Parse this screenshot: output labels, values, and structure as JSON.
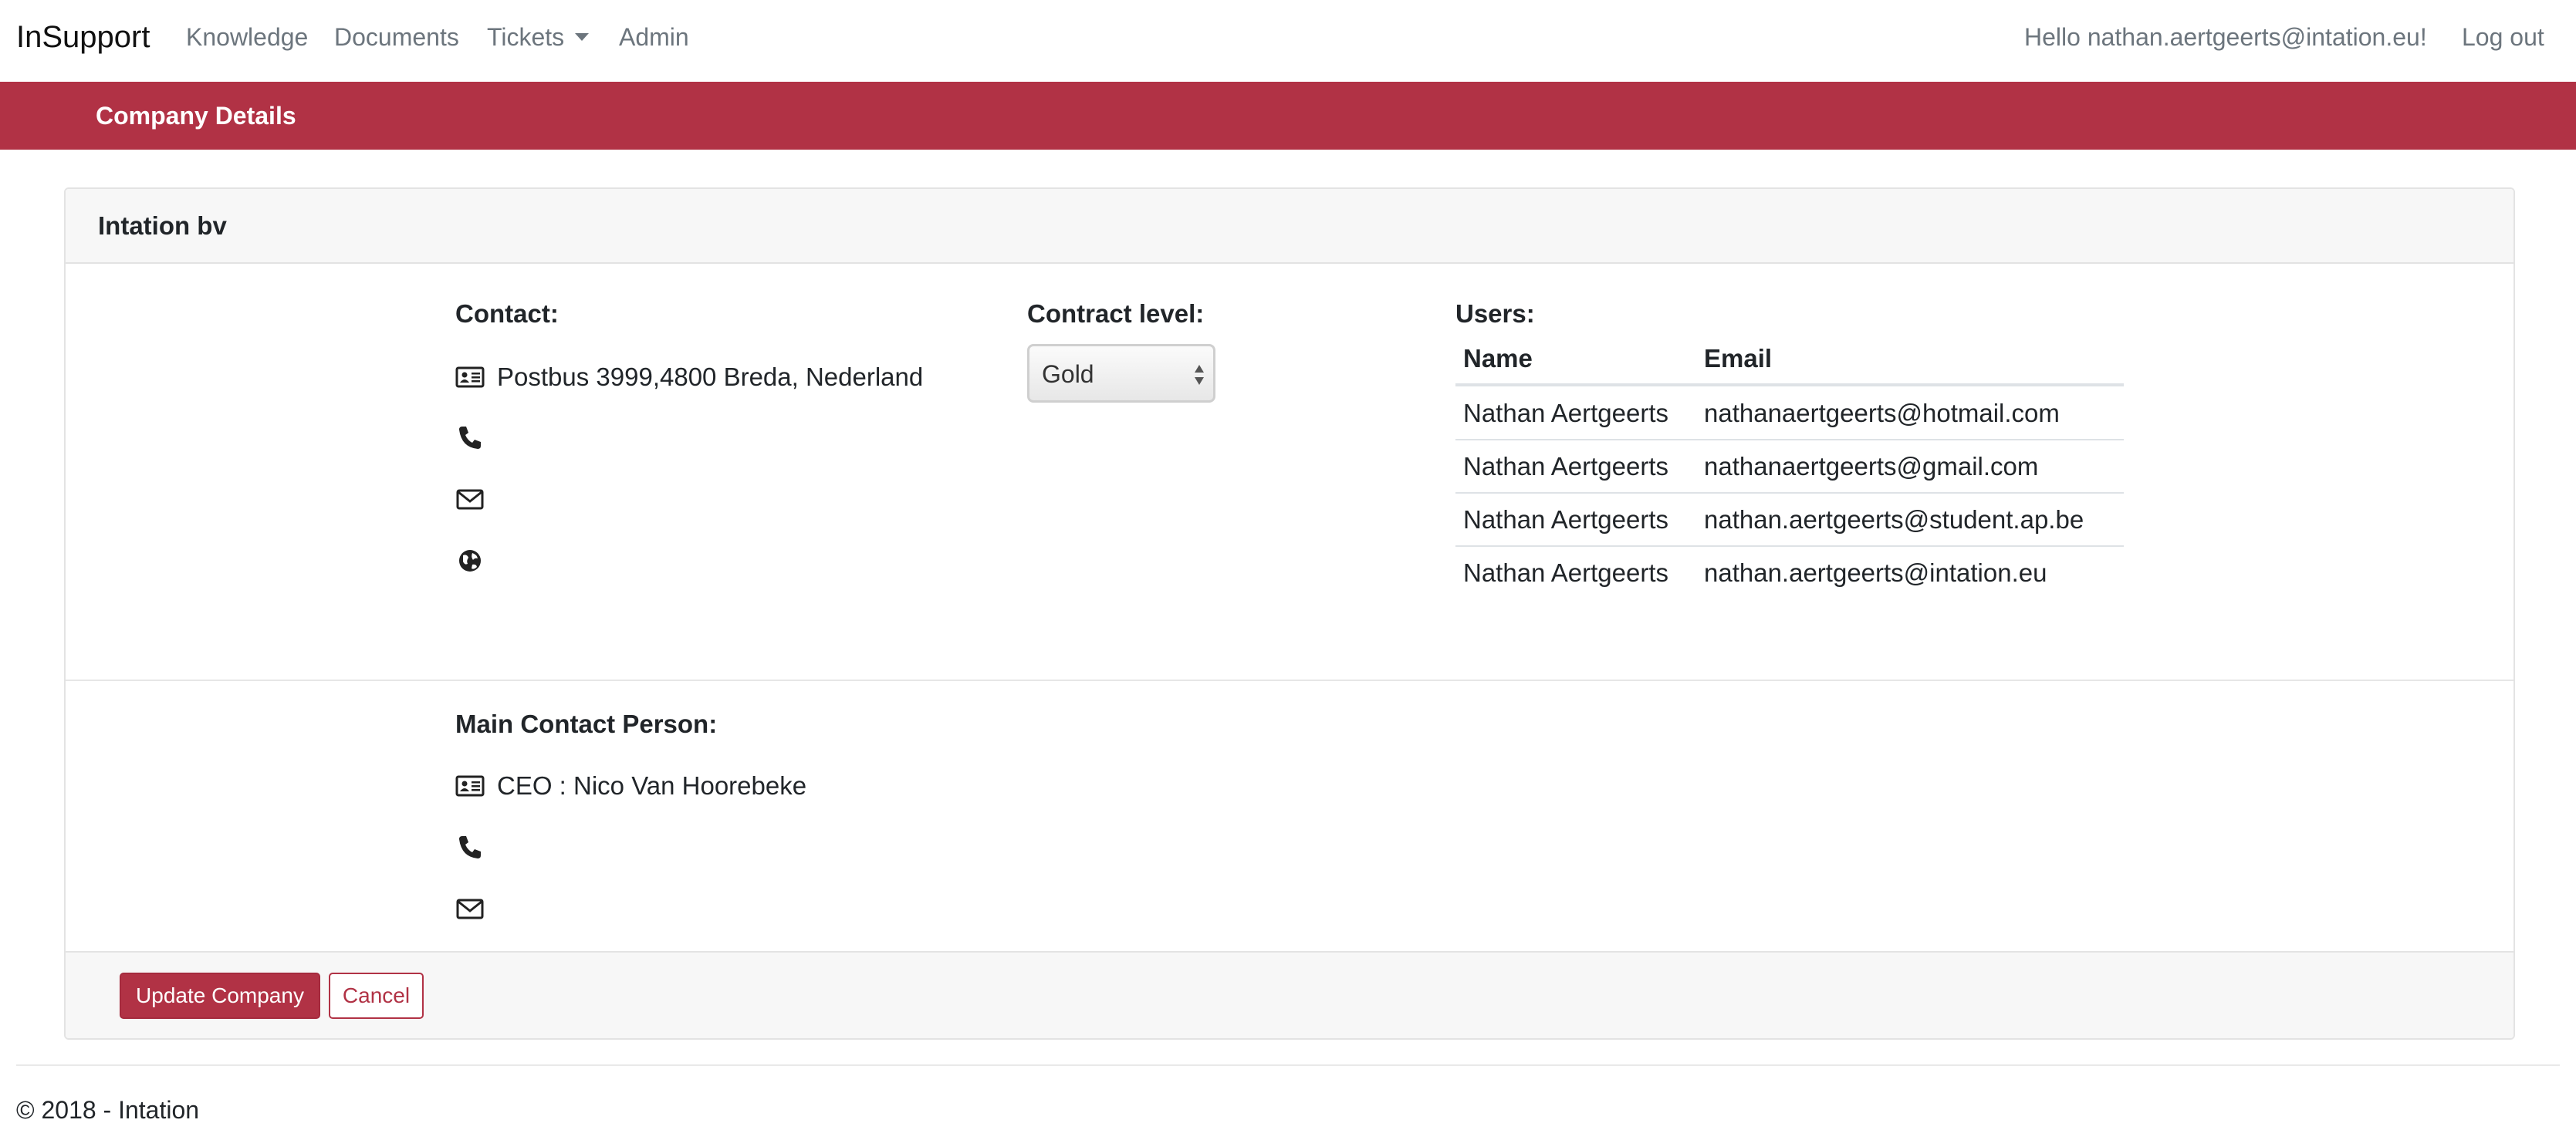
{
  "navbar": {
    "brand": "InSupport",
    "links": [
      "Knowledge",
      "Documents",
      "Tickets",
      "Admin"
    ],
    "greeting": "Hello nathan.aertgeerts@intation.eu!",
    "logout": "Log out"
  },
  "banner": {
    "title": "Company Details"
  },
  "company": {
    "name": "Intation bv",
    "contact_label": "Contact:",
    "address": "Postbus 3999,4800 Breda, Nederland",
    "contract_label": "Contract level:",
    "contract_value": "Gold",
    "users_label": "Users:",
    "users_columns": [
      "Name",
      "Email"
    ],
    "users": [
      {
        "name": "Nathan Aertgeerts",
        "email": "nathanaertgeerts@hotmail.com"
      },
      {
        "name": "Nathan Aertgeerts",
        "email": "nathanaertgeerts@gmail.com"
      },
      {
        "name": "Nathan Aertgeerts",
        "email": "nathan.aertgeerts@student.ap.be"
      },
      {
        "name": "Nathan Aertgeerts",
        "email": "nathan.aertgeerts@intation.eu"
      }
    ],
    "main_contact_label": "Main Contact Person:",
    "main_contact": "CEO : Nico Van Hoorebeke"
  },
  "actions": {
    "update": "Update Company",
    "cancel": "Cancel"
  },
  "footer": {
    "text": "© 2018 - Intation"
  },
  "icons": {
    "address": "id-card-icon",
    "phone": "phone-icon",
    "email": "envelope-icon",
    "website": "globe-icon"
  },
  "colors": {
    "accent": "#b13245",
    "muted_link": "#6c757d"
  }
}
